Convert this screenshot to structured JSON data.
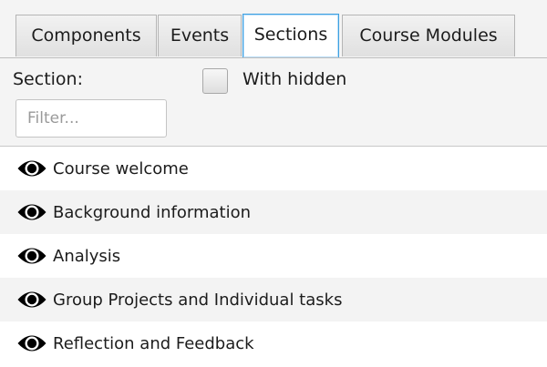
{
  "tabs": [
    {
      "label": "Components",
      "selected": false
    },
    {
      "label": "Events",
      "selected": false
    },
    {
      "label": "Sections",
      "selected": true
    },
    {
      "label": "Course Modules",
      "selected": false
    }
  ],
  "filter_panel": {
    "section_label": "Section:",
    "with_hidden_label": "With hidden",
    "with_hidden_checked": false,
    "filter_placeholder": "Filter...",
    "filter_value": ""
  },
  "sections": [
    {
      "label": "Course welcome",
      "icon": "eye-icon"
    },
    {
      "label": "Background information",
      "icon": "eye-icon"
    },
    {
      "label": "Analysis",
      "icon": "eye-icon"
    },
    {
      "label": "Group Projects and Individual tasks",
      "icon": "eye-icon"
    },
    {
      "label": "Reflection and Feedback",
      "icon": "eye-icon"
    }
  ],
  "colors": {
    "selected_tab_border": "#3ea0e0",
    "panel_background": "#f4f4f4",
    "alt_row": "#f3f3f3"
  }
}
